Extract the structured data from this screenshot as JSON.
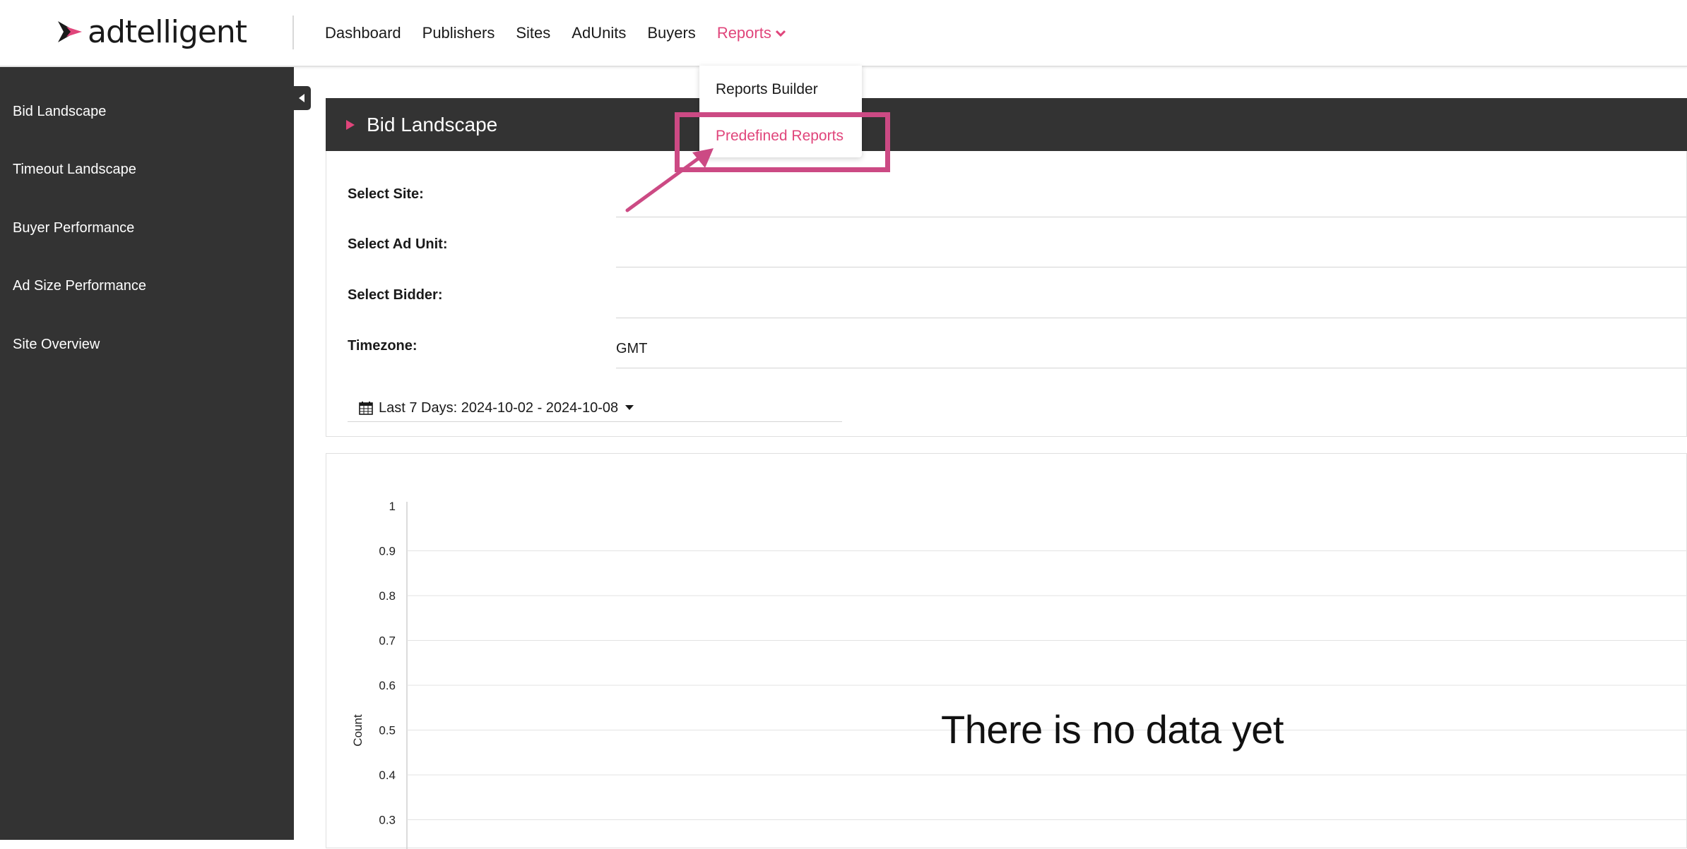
{
  "brand": {
    "name": "adtelligent",
    "accent": "#e0457b"
  },
  "nav": {
    "items": [
      {
        "label": "Dashboard"
      },
      {
        "label": "Publishers"
      },
      {
        "label": "Sites"
      },
      {
        "label": "AdUnits"
      },
      {
        "label": "Buyers"
      }
    ],
    "active": {
      "label": "Reports"
    }
  },
  "dropdown": {
    "items": [
      {
        "label": "Reports Builder"
      },
      {
        "label": "Predefined Reports"
      }
    ]
  },
  "sidebar": {
    "items": [
      {
        "label": "Bid Landscape"
      },
      {
        "label": "Timeout Landscape"
      },
      {
        "label": "Buyer Performance"
      },
      {
        "label": "Ad Size Performance"
      },
      {
        "label": "Site Overview"
      }
    ]
  },
  "panel": {
    "title": "Bid Landscape",
    "filters": {
      "site_label": "Select Site:",
      "adunit_label": "Select Ad Unit:",
      "bidder_label": "Select Bidder:",
      "timezone_label": "Timezone:",
      "timezone_value": "GMT"
    },
    "date_range": "Last 7 Days: 2024-10-02 - 2024-10-08"
  },
  "chart_data": {
    "type": "line",
    "ylabel": "Count",
    "yticks": [
      "1",
      "0.9",
      "0.8",
      "0.7",
      "0.6",
      "0.5",
      "0.4",
      "0.3"
    ],
    "empty_message": "There is no data yet"
  }
}
